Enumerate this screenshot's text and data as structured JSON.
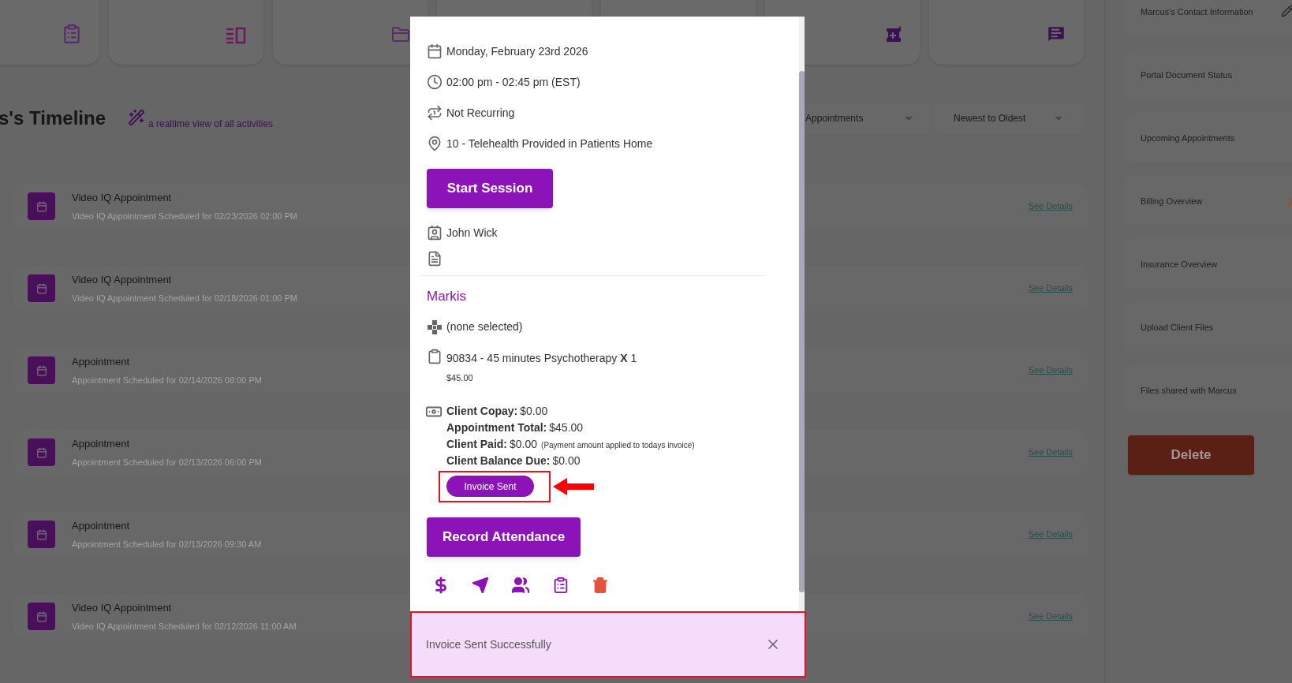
{
  "timeline": {
    "title": "s's Timeline",
    "subtitle": "a realtime view of all activities"
  },
  "filters": [
    {
      "value": "Appointments"
    },
    {
      "value": "Newest to Oldest"
    }
  ],
  "timeline_items": [
    {
      "title": "Video IQ Appointment",
      "description": "Video IQ Appointment Scheduled for 02/23/2026 02:00 PM",
      "link": "See Details"
    },
    {
      "title": "Video IQ Appointment",
      "description": "Video IQ Appointment Scheduled for 02/18/2026 01:00 PM",
      "link": "See Details"
    },
    {
      "title": "Appointment",
      "description": "Appointment Scheduled for 02/14/2026 08:00 PM",
      "link": "See Details"
    },
    {
      "title": "Appointment",
      "description": "Appointment Scheduled for 02/13/2026 06:00 PM",
      "link": "See Details"
    },
    {
      "title": "Appointment",
      "description": "Appointment Scheduled for 02/13/2026 09:30 AM",
      "link": "See Details"
    },
    {
      "title": "Video IQ Appointment",
      "description": "Video IQ Appointment Scheduled for 02/12/2026 11:00 AM",
      "link": "See Details"
    }
  ],
  "sidebar": {
    "items": [
      "Marcus's Contact Information",
      "Portal Document Status",
      "Upcoming Appointments",
      "Billing Overview",
      "Insurance Overview",
      "Upload Client Files",
      "Files shared with Marcus"
    ],
    "delete_button": "Delete"
  },
  "appointment": {
    "date": "Monday, February 23rd 2026",
    "time": "02:00 pm - 02:45 pm (EST)",
    "recurrence": "Not Recurring",
    "location": "10 - Telehealth Provided in Patients Home",
    "start_button": "Start Session",
    "provider": "John Wick",
    "client": "Markis",
    "service_selection": "(none selected)",
    "service": "90834 - 45 minutes Psychotherapy **X** 1",
    "service_price": "$45.00",
    "billing": [
      {
        "label": "Client Copay:",
        "value": "$0.00"
      },
      {
        "label": "Appointment Total:",
        "value": "$45.00"
      },
      {
        "label": "Client Paid:",
        "value": "$0.00",
        "note": "(Payment amount applied to todays invoice)"
      },
      {
        "label": "Client Balance Due:",
        "value": "$0.00"
      }
    ],
    "invoice_button": "Invoice Sent",
    "attendance_button": "Record Attendance"
  },
  "toast": {
    "message": "Invoice Sent Successfully"
  }
}
